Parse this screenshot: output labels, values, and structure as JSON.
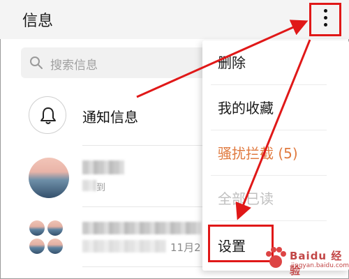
{
  "header": {
    "title": "信息"
  },
  "search": {
    "placeholder": "搜索信息"
  },
  "notice": {
    "label": "通知信息"
  },
  "conversations": [
    {
      "snippet": "到"
    },
    {
      "time": "11月2"
    }
  ],
  "menu": {
    "items": [
      {
        "label": "删除"
      },
      {
        "label": "我的收藏"
      },
      {
        "label": "骚扰拦截 (5)"
      },
      {
        "label": "全部已读"
      },
      {
        "label": "设置"
      }
    ]
  },
  "watermark": {
    "text": "Baidu 经验",
    "sub": "jingyan.baidu.com"
  },
  "colors": {
    "highlight": "#e01818",
    "accent_orange": "#e07a3f"
  },
  "icons": [
    "more-vertical-icon",
    "search-icon",
    "bell-icon"
  ]
}
